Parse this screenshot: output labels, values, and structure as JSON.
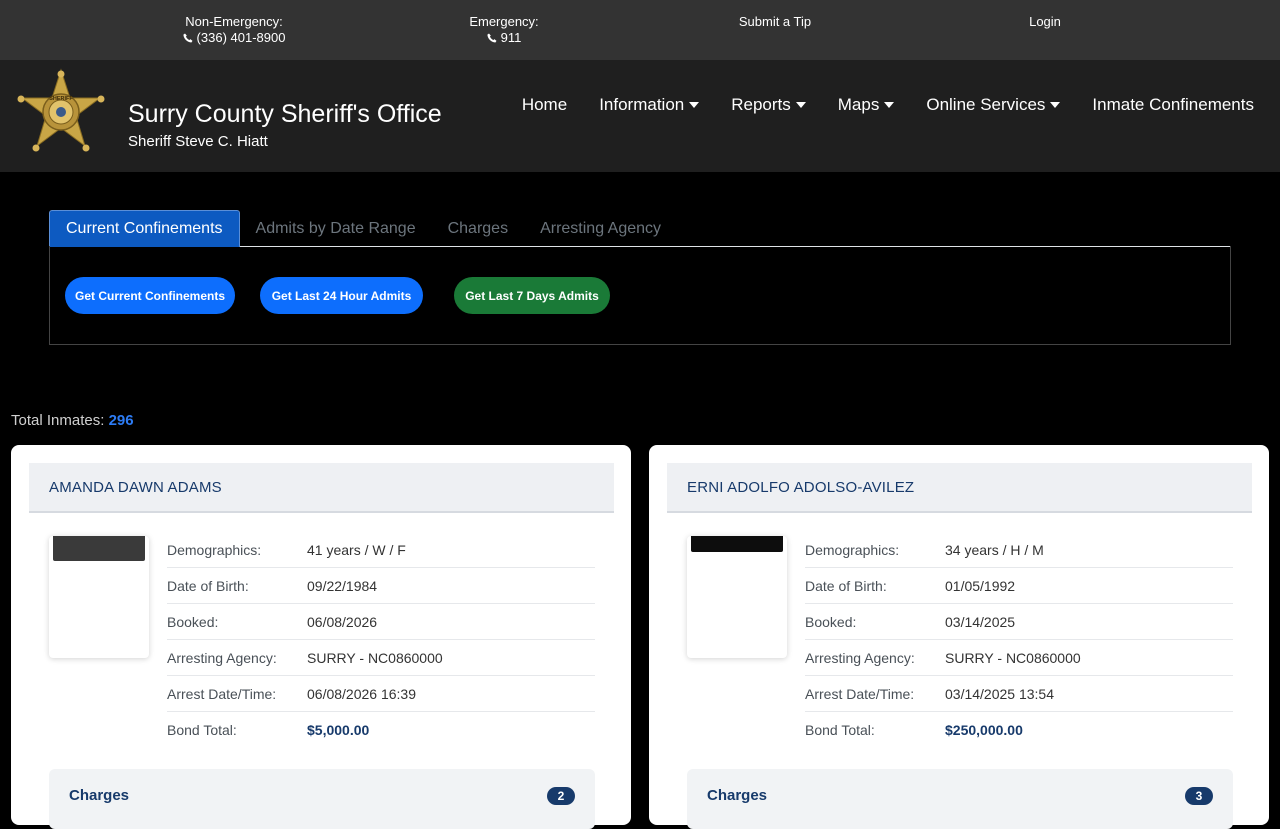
{
  "topbar": {
    "non_emergency_label": "Non-Emergency:",
    "non_emergency_phone": "(336) 401-8900",
    "emergency_label": "Emergency:",
    "emergency_phone": "911",
    "tip": "Submit a Tip",
    "login": "Login"
  },
  "header": {
    "title": "Surry County Sheriff's Office",
    "subtitle": "Sheriff Steve C. Hiatt",
    "badge_text": "SHERIFF",
    "nav": [
      "Home",
      "Information",
      "Reports",
      "Maps",
      "Online Services",
      "Inmate Confinements"
    ]
  },
  "tabs": [
    "Current Confinements",
    "Admits by Date Range",
    "Charges",
    "Arresting Agency"
  ],
  "buttons": {
    "current": "Get Current Confinements",
    "last24": "Get Last 24 Hour Admits",
    "last7": "Get Last 7 Days Admits"
  },
  "total": {
    "label": "Total Inmates:",
    "count": "296"
  },
  "labels": {
    "demographics": "Demographics:",
    "dob": "Date of Birth:",
    "booked": "Booked:",
    "agency": "Arresting Agency:",
    "arrest": "Arrest Date/Time:",
    "bond": "Bond Total:",
    "charges": "Charges"
  },
  "inmates": [
    {
      "name": "AMANDA DAWN ADAMS",
      "demographics": "41 years / W / F",
      "dob": "09/22/1984",
      "booked": "06/08/2026",
      "agency": "SURRY - NC0860000",
      "arrest": "06/08/2026 16:39",
      "bond": "$5,000.00",
      "charges_count": "2"
    },
    {
      "name": "ERNI ADOLFO ADOLSO-AVILEZ",
      "demographics": "34 years / H / M",
      "dob": "01/05/1992",
      "booked": "03/14/2025",
      "agency": "SURRY - NC0860000",
      "arrest": "03/14/2025 13:54",
      "bond": "$250,000.00",
      "charges_count": "3"
    }
  ]
}
